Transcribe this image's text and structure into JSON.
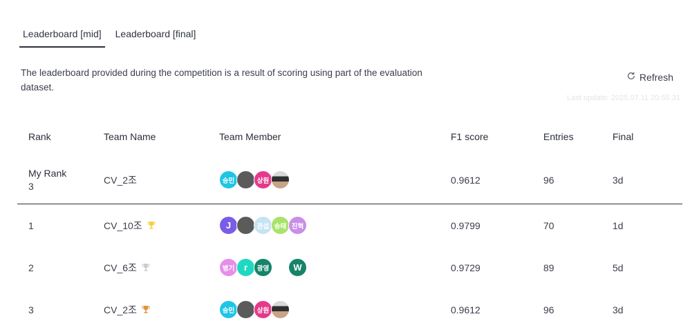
{
  "tabs": [
    {
      "label": "Leaderboard [mid]",
      "active": true
    },
    {
      "label": "Leaderboard [final]",
      "active": false
    }
  ],
  "description": "The leaderboard provided during the competition is a result of scoring using part of the evaluation dataset.",
  "refresh_label": "Refresh",
  "last_update": "Last update: 2025.07.11 20:55:31",
  "table": {
    "headers": {
      "rank": "Rank",
      "team": "Team Name",
      "member": "Team Member",
      "f1": "F1 score",
      "entries": "Entries",
      "final": "Final"
    },
    "my_rank": {
      "title": "My Rank",
      "rank": "3",
      "team": "CV_2조",
      "f1": "0.9612",
      "entries": "96",
      "final": "3d",
      "members": [
        {
          "label": "승민",
          "color": "#1fc5e6"
        },
        {
          "label": "",
          "color": "#6a6a6a"
        },
        {
          "label": "상원",
          "color": "#e43a8b"
        },
        {
          "label": "",
          "color": "#8a8a8a"
        }
      ]
    },
    "rows": [
      {
        "rank": "1",
        "team": "CV_10조",
        "trophy_color": "#f1d23a",
        "f1": "0.9799",
        "entries": "70",
        "final": "1d",
        "members": [
          {
            "label": "J",
            "color": "#7b5ce6"
          },
          {
            "label": "",
            "color": "#3bd16c"
          },
          {
            "label": "관섭",
            "color": "#c6e3f2"
          },
          {
            "label": "승태",
            "color": "#a8e36a"
          },
          {
            "label": "진혁",
            "color": "#c98ee8"
          }
        ]
      },
      {
        "rank": "2",
        "team": "CV_6조",
        "trophy_color": "#c8ccd2",
        "f1": "0.9729",
        "entries": "89",
        "final": "5d",
        "members": [
          {
            "label": "병기",
            "color": "#e68ee8"
          },
          {
            "label": "r",
            "color": "#1ed9c2"
          },
          {
            "label": "광영",
            "color": "#16836b"
          },
          {
            "label": "",
            "color": "transparent"
          },
          {
            "label": "W",
            "color": "#16836b"
          }
        ]
      },
      {
        "rank": "3",
        "team": "CV_2조",
        "trophy_color": "#e0923a",
        "f1": "0.9612",
        "entries": "96",
        "final": "3d",
        "members": [
          {
            "label": "승민",
            "color": "#1fc5e6"
          },
          {
            "label": "",
            "color": "#6a6a6a"
          },
          {
            "label": "상원",
            "color": "#e43a8b"
          },
          {
            "label": "",
            "color": "#8a8a8a"
          }
        ]
      }
    ]
  },
  "icons": {
    "refresh": "refresh-icon",
    "trophy": "trophy-icon"
  }
}
